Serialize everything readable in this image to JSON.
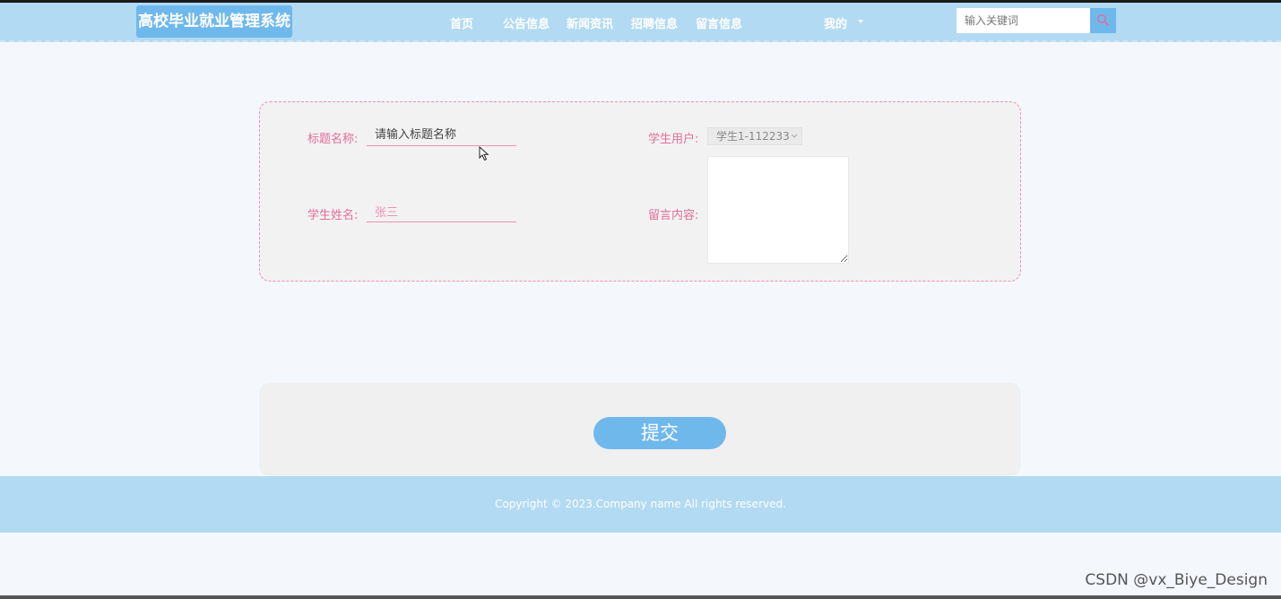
{
  "header": {
    "logo_text": "高校毕业就业管理系统",
    "nav": [
      {
        "label": "首页"
      },
      {
        "label": "公告信息"
      },
      {
        "label": "新闻资讯"
      },
      {
        "label": "招聘信息"
      },
      {
        "label": "留言信息"
      }
    ],
    "user_menu_label": "我的",
    "search": {
      "placeholder": "输入关键词"
    }
  },
  "form": {
    "title_label": "标题名称:",
    "title_placeholder": "请输入标题名称",
    "student_user_label": "学生用户:",
    "student_user_value": "学生1-112233",
    "student_name_label": "学生姓名:",
    "student_name_value": "张三",
    "content_label": "留言内容:",
    "content_value": ""
  },
  "submit_label": "提交",
  "footer": {
    "copyright": "Copyright © 2023.Company name All rights reserved."
  },
  "watermark": "CSDN @vx_Biye_Design",
  "colors": {
    "header_bg": "#b2daf3",
    "accent_blue": "#6fb8ec",
    "label_pink": "#e56c9b",
    "border_pink": "#f08fb4",
    "page_bg": "#f4f7fb"
  }
}
